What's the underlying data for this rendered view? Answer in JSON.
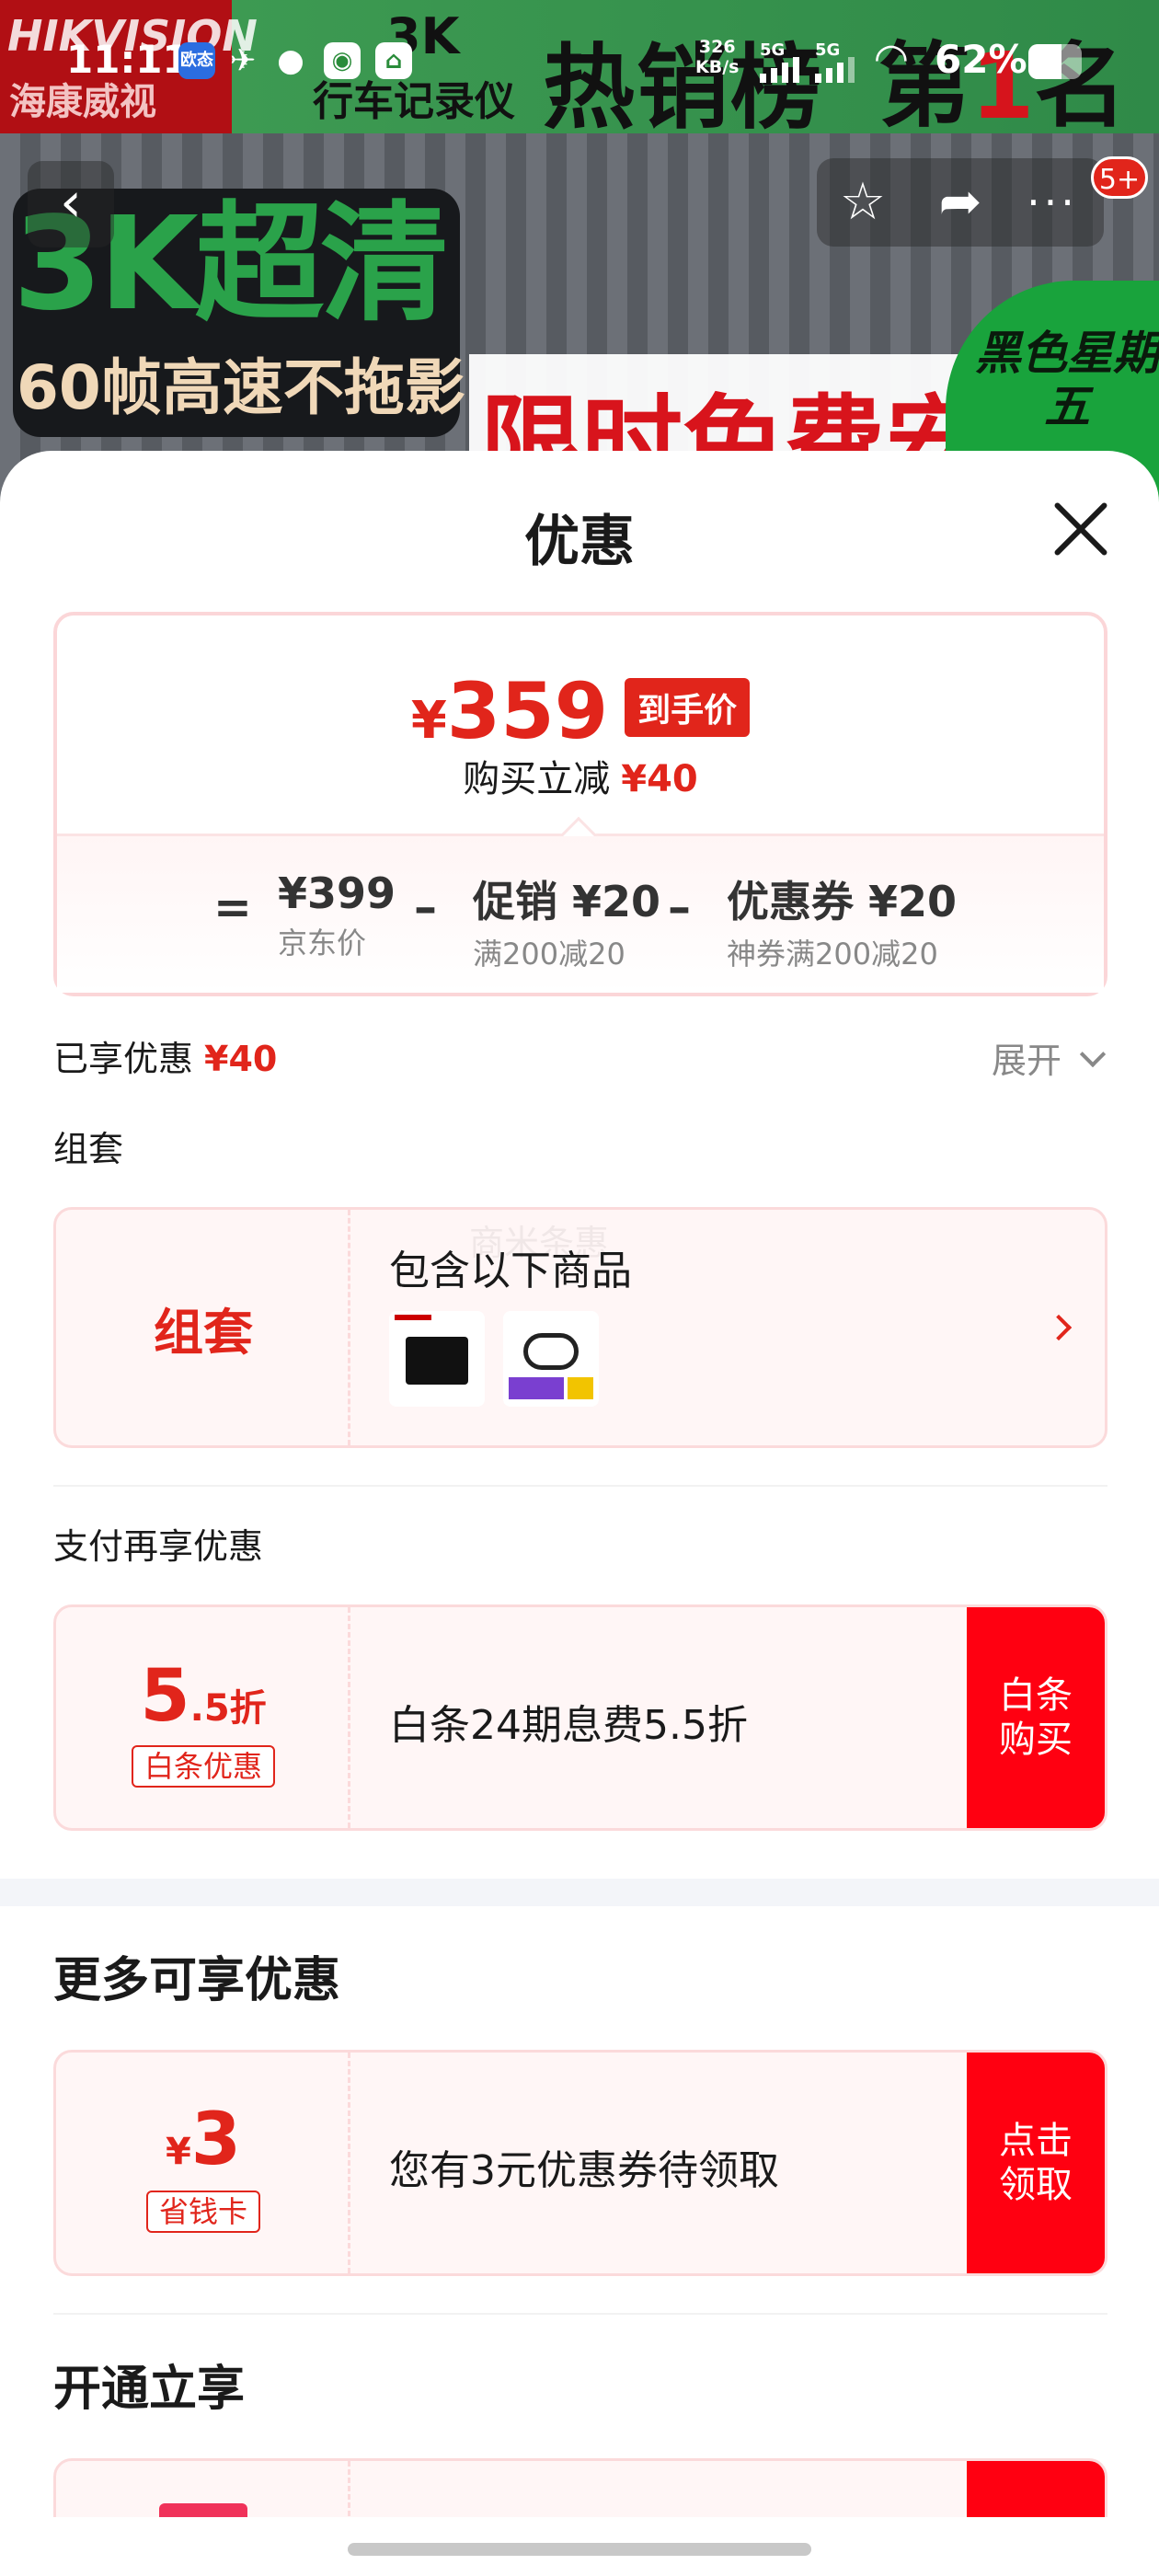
{
  "status_bar": {
    "time": "11:11",
    "app_icons": [
      "欧态",
      "bird-icon",
      "wechat-icon",
      "app-icon",
      "home-app-icon"
    ],
    "net_speed_top": "326",
    "net_speed_unit": "KB/s",
    "sim1": "5G",
    "sim2": "5G",
    "battery_pct": "62%",
    "battery_level": 0.62
  },
  "hero": {
    "brand": "HIKVISION",
    "brand_cn": "海康威视",
    "label_3k": "3K",
    "label_sub": "行车记录仪",
    "hot": "热销榜",
    "rank_prefix": "第",
    "rank_num": "1",
    "rank_suffix": "名",
    "big1": "3K超清",
    "big2": "60帧高速不拖影",
    "promo": "限时免费安",
    "friday": "黑色星期五",
    "badge": "5+"
  },
  "sheet": {
    "title": "优惠",
    "price": {
      "yen": "¥",
      "value": "359",
      "tag": "到手价",
      "reduce_label": "购买立减",
      "reduce_value": "¥40"
    },
    "calc": {
      "equals": "=",
      "jd_price": "¥399",
      "jd_label": "京东价",
      "minus1": "–",
      "promo_value": "促销 ¥20",
      "promo_label": "满200减20",
      "minus2": "–",
      "coupon_value": "优惠券 ¥20",
      "coupon_label": "神券满200减20"
    },
    "enjoyed_label": "已享优惠",
    "enjoyed_value": "¥40",
    "expand_label": "展开",
    "bundle_section": "组套",
    "bundle": {
      "label": "组套",
      "title": "包含以下商品",
      "watermark": "商米条惠"
    },
    "pay_section": "支付再享优惠",
    "baitiao": {
      "num_big": "5",
      "num_small": ".5折",
      "tag": "白条优惠",
      "text": "白条24期息费5.5折",
      "action_line1": "白条",
      "action_line2": "购买"
    },
    "more_section": "更多可享优惠",
    "coupon": {
      "yen": "¥",
      "num": "3",
      "tag": "省钱卡",
      "text": "您有3元优惠券待领取",
      "action_line1": "点击",
      "action_line2": "领取"
    },
    "open_section": "开通立享"
  },
  "colors": {
    "accent": "#e1251b",
    "action": "#ff0011",
    "card_bg": "#fff6f6",
    "card_border": "#fbdadb"
  }
}
